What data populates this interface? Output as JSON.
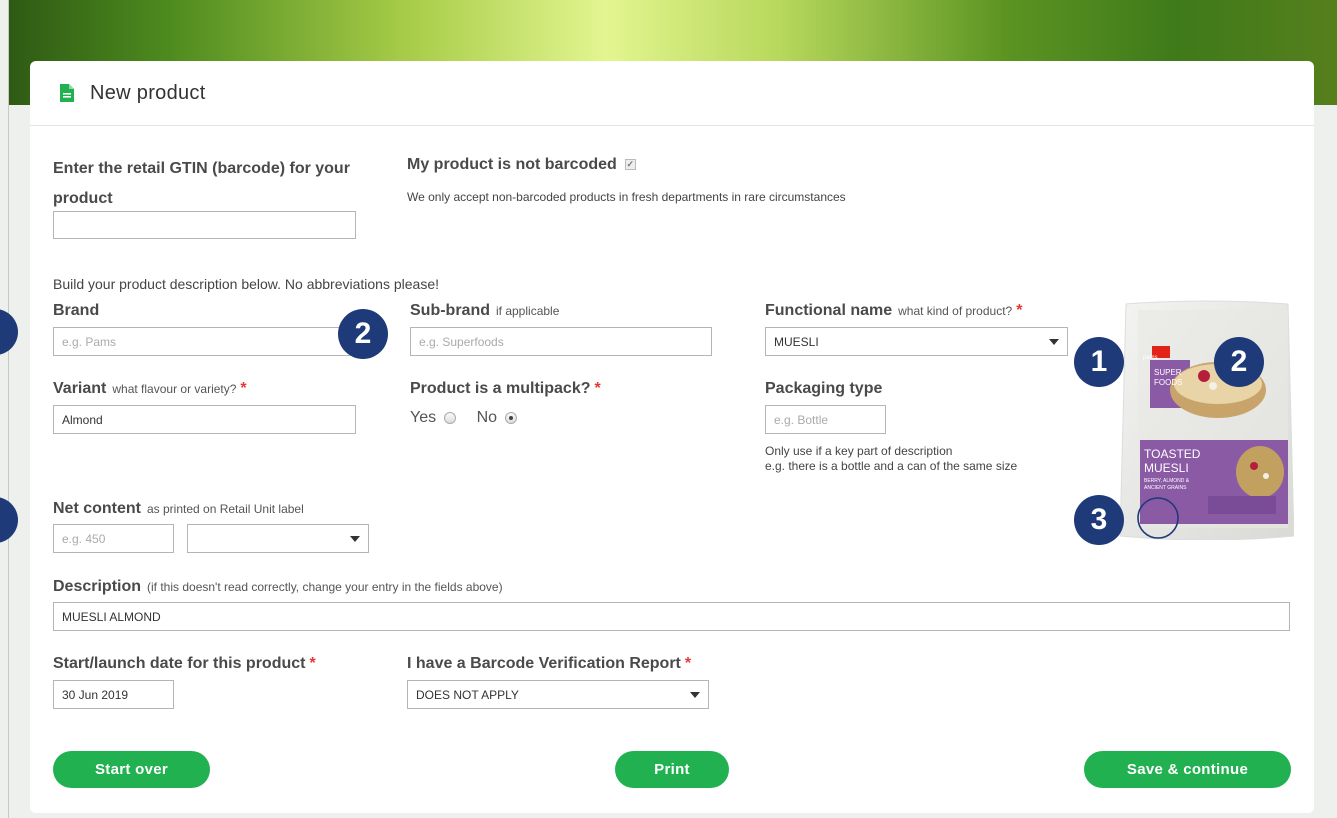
{
  "card": {
    "title": "New product"
  },
  "gtin": {
    "label": "Enter the retail GTIN (barcode) for your product",
    "value": ""
  },
  "not_barcoded": {
    "label": "My product is not barcoded",
    "checked": true,
    "note": "We only accept non-barcoded products in fresh departments in rare circumstances"
  },
  "build_intro": "Build your product description below. No abbreviations please!",
  "brand": {
    "label": "Brand",
    "placeholder": "e.g. Pams"
  },
  "subbrand": {
    "label": "Sub-brand",
    "hint": "if applicable",
    "placeholder": "e.g. Superfoods"
  },
  "functional": {
    "label": "Functional name",
    "hint": "what kind of product?",
    "required": "*",
    "value": "MUESLI"
  },
  "variant": {
    "label": "Variant",
    "hint": "what flavour or variety?",
    "required": "*",
    "value": "Almond"
  },
  "multipack": {
    "label": "Product is a multipack?",
    "required": "*",
    "yes": "Yes",
    "no": "No",
    "selected": "No"
  },
  "packaging": {
    "label": "Packaging type",
    "placeholder": "e.g. Bottle",
    "note_line1": "Only use if a key part of description",
    "note_line2": "e.g. there is a bottle and a can of the same size"
  },
  "net_content": {
    "label": "Net content",
    "hint": "as printed on Retail Unit label",
    "placeholder": "e.g. 450",
    "unit": ""
  },
  "description": {
    "label": "Description",
    "hint": "(if this doesn't read correctly, change your entry in the fields above)",
    "value": "MUESLI ALMOND"
  },
  "launch_date": {
    "label": "Start/launch date for this product",
    "required": "*",
    "value": "30 Jun 2019"
  },
  "verification": {
    "label": "I have a Barcode Verification Report",
    "required": "*",
    "value": "DOES NOT APPLY"
  },
  "buttons": {
    "start_over": "Start over",
    "print": "Print",
    "save": "Save & continue"
  },
  "badges": {
    "b1": "1",
    "b2": "2",
    "b3": "3"
  },
  "product_pack": {
    "brand": "pams",
    "line1": "SUPER",
    "line2": "FOODS",
    "title1": "TOASTED",
    "title2": "MUESLI",
    "sub1": "BERRY, ALMOND &",
    "sub2": "ANCIENT GRAINS"
  },
  "colors": {
    "accent": "#21b150",
    "badge": "#1e3a78",
    "required": "#e53935",
    "pack_purple": "#8a5aa5"
  },
  "icons": {
    "doc": "document-icon",
    "caret": "chevron-down-icon"
  }
}
